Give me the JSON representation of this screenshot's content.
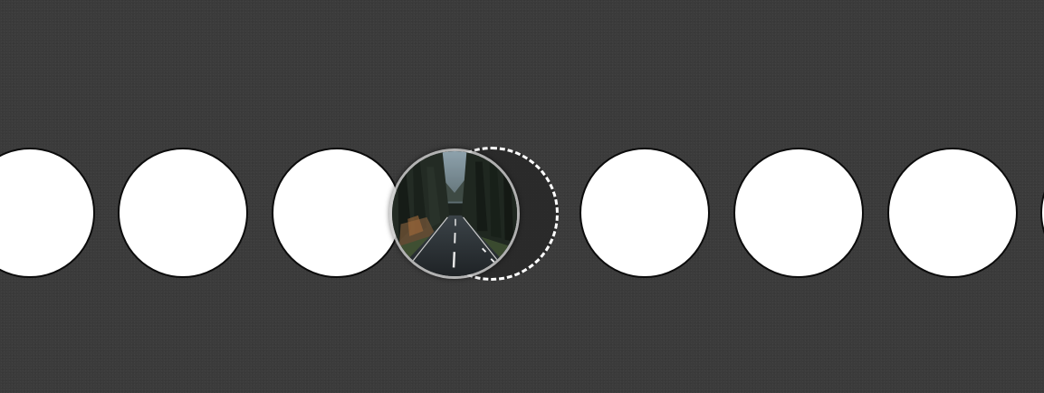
{
  "tiles": [
    {
      "icon": "white-circle-tile"
    },
    {
      "icon": "white-circle-tile"
    },
    {
      "icon": "white-circle-tile"
    },
    {
      "icon": "road-photo-tile"
    },
    {
      "icon": "white-circle-tile"
    },
    {
      "icon": "white-circle-tile"
    },
    {
      "icon": "white-circle-tile"
    },
    {
      "icon": "white-circle-tile"
    }
  ],
  "colors": {
    "background": "#3b3b3b",
    "tile_fill": "#ffffff",
    "tile_border": "#0c0c0c",
    "drop_outline": "#ffffff"
  }
}
